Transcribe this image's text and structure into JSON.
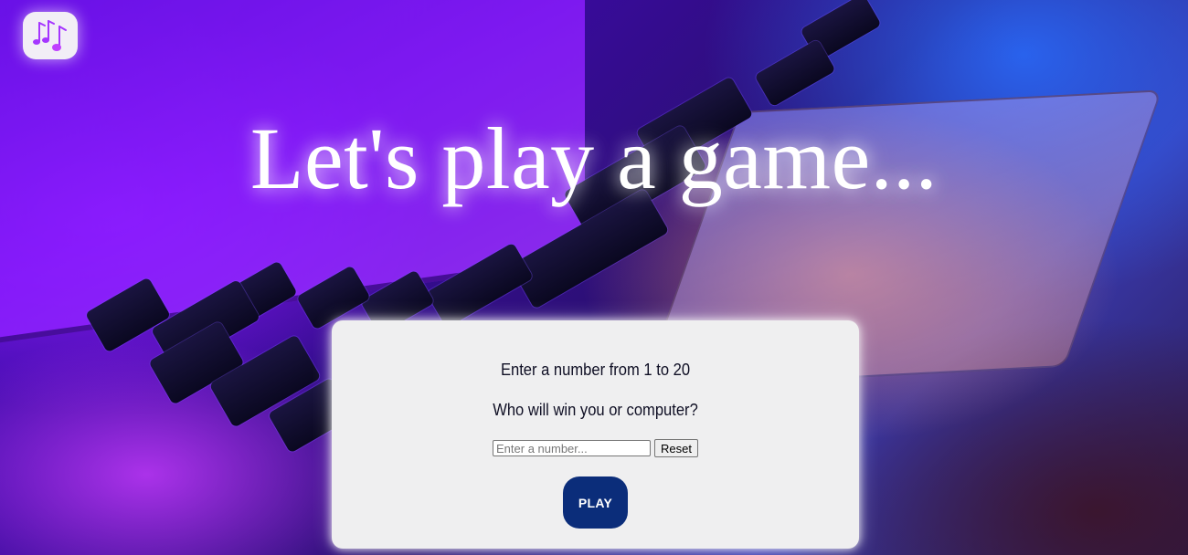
{
  "header": {
    "logo_icon": "music-notes-icon",
    "logo_colors": [
      "#9b30ff",
      "#c040ff"
    ]
  },
  "hero": {
    "title": "Let's play a game..."
  },
  "game": {
    "prompt": "Enter a number from 1 to 20",
    "question": "Who will win you or computer?",
    "input": {
      "placeholder": "Enter a number...",
      "value": ""
    },
    "reset_label": "Reset",
    "play_label": "PLAY"
  },
  "colors": {
    "play_button": "#0b2d7a",
    "card_background": "#efeff0",
    "text_dark": "#0f0f24"
  }
}
